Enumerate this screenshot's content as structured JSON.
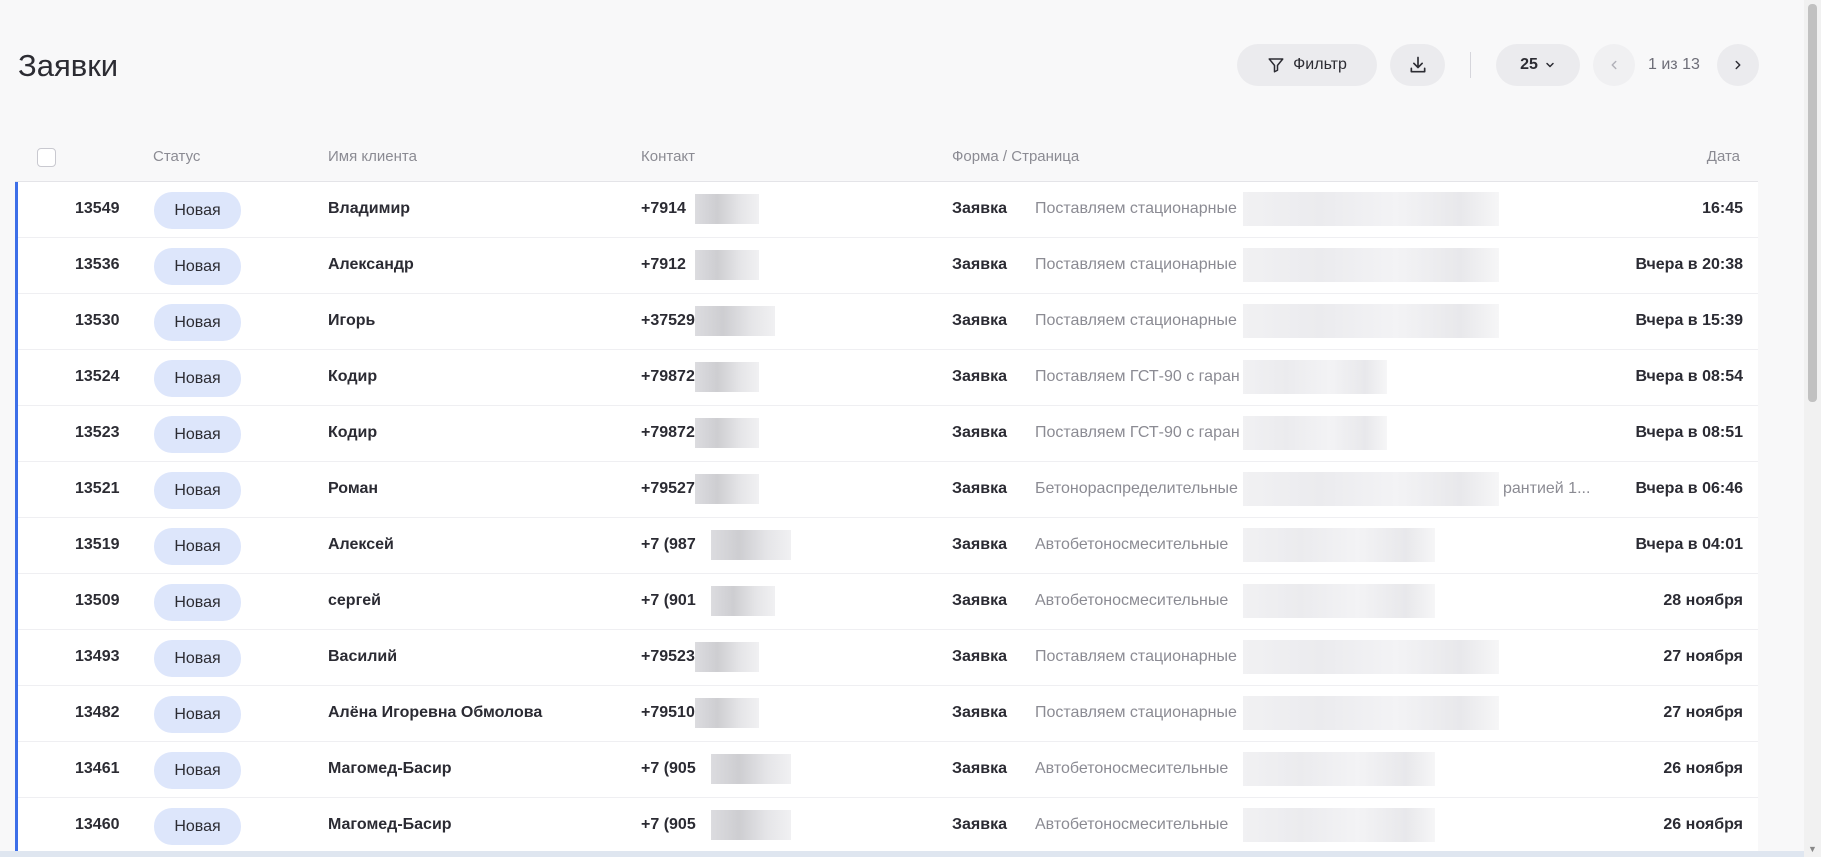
{
  "page": {
    "title": "Заявки"
  },
  "toolbar": {
    "filter_label": "Фильтр",
    "per_page": "25",
    "pagination": "1 из 13"
  },
  "table": {
    "headers": {
      "status": "Статус",
      "client": "Имя клиента",
      "contact": "Контакт",
      "form_page": "Форма / Страница",
      "date": "Дата"
    },
    "rows": [
      {
        "id": "13549",
        "status": "Новая",
        "name": "Владимир",
        "contact": "+7914",
        "form": "Заявка",
        "page": "Поставляем стационарные",
        "page_tail": "",
        "date": "16:45"
      },
      {
        "id": "13536",
        "status": "Новая",
        "name": "Александр",
        "contact": "+7912",
        "form": "Заявка",
        "page": "Поставляем стационарные",
        "page_tail": "",
        "date": "Вчера в 20:38"
      },
      {
        "id": "13530",
        "status": "Новая",
        "name": "Игорь",
        "contact": "+37529",
        "form": "Заявка",
        "page": "Поставляем стационарные",
        "page_tail": "",
        "date": "Вчера в 15:39"
      },
      {
        "id": "13524",
        "status": "Новая",
        "name": "Кодир",
        "contact": "+79872",
        "form": "Заявка",
        "page": "Поставляем ГСТ-90 с гаран",
        "page_tail": "",
        "date": "Вчера в 08:54"
      },
      {
        "id": "13523",
        "status": "Новая",
        "name": "Кодир",
        "contact": "+79872",
        "form": "Заявка",
        "page": "Поставляем ГСТ-90 с гаран",
        "page_tail": "",
        "date": "Вчера в 08:51"
      },
      {
        "id": "13521",
        "status": "Новая",
        "name": "Роман",
        "contact": "+79527",
        "form": "Заявка",
        "page": "Бетонораспределительные",
        "page_tail": "рантией 1...",
        "date": "Вчера в 06:46"
      },
      {
        "id": "13519",
        "status": "Новая",
        "name": "Алексей",
        "contact": "+7 (987",
        "form": "Заявка",
        "page": "Автобетоносмесительные",
        "page_tail": "",
        "date": "Вчера в 04:01"
      },
      {
        "id": "13509",
        "status": "Новая",
        "name": "сергей",
        "contact": "+7 (901",
        "form": "Заявка",
        "page": "Автобетоносмесительные",
        "page_tail": "",
        "date": "28 ноября"
      },
      {
        "id": "13493",
        "status": "Новая",
        "name": "Василий",
        "contact": "+79523",
        "form": "Заявка",
        "page": "Поставляем стационарные",
        "page_tail": "",
        "date": "27 ноября"
      },
      {
        "id": "13482",
        "status": "Новая",
        "name": "Алёна Игоревна Обмолова",
        "contact": "+79510",
        "form": "Заявка",
        "page": "Поставляем стационарные",
        "page_tail": "",
        "date": "27 ноября"
      },
      {
        "id": "13461",
        "status": "Новая",
        "name": "Магомед-Басир",
        "contact": "+7 (905",
        "form": "Заявка",
        "page": "Автобетоносмесительные",
        "page_tail": "",
        "date": "26 ноября"
      },
      {
        "id": "13460",
        "status": "Новая",
        "name": "Магомед-Басир",
        "contact": "+7 (905",
        "form": "Заявка",
        "page": "Автобетоносмесительные",
        "page_tail": "",
        "date": "26 ноября"
      }
    ]
  },
  "icons": {
    "filter": "filter-icon",
    "download": "download-icon",
    "per_page_chevron": "chevron-down-icon",
    "prev": "chevron-left-icon",
    "next": "chevron-right-icon"
  },
  "colors": {
    "accent": "#3d6fe8",
    "status_badge": "#dde6fb",
    "muted_text": "#8b8b93"
  }
}
